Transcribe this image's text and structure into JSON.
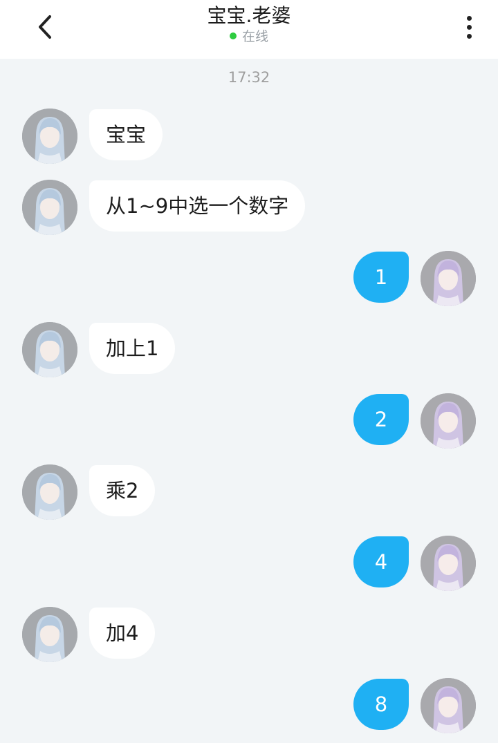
{
  "header": {
    "title": "宝宝.老婆",
    "status": "在线",
    "status_color": "#2ecc40",
    "back_icon": "chevron-left-icon",
    "more_icon": "more-vertical-icon"
  },
  "chat": {
    "timestamp": "17:32",
    "messages": [
      {
        "side": "incoming",
        "text": "宝宝"
      },
      {
        "side": "incoming",
        "text": "从1~9中选一个数字"
      },
      {
        "side": "outgoing",
        "text": "1"
      },
      {
        "side": "incoming",
        "text": "加上1"
      },
      {
        "side": "outgoing",
        "text": "2"
      },
      {
        "side": "incoming",
        "text": "乘2"
      },
      {
        "side": "outgoing",
        "text": "4"
      },
      {
        "side": "incoming",
        "text": "加4"
      },
      {
        "side": "outgoing",
        "text": "8"
      }
    ]
  },
  "colors": {
    "background": "#f2f5f7",
    "outgoing_bubble": "#1fb0f3",
    "incoming_bubble": "#ffffff"
  }
}
